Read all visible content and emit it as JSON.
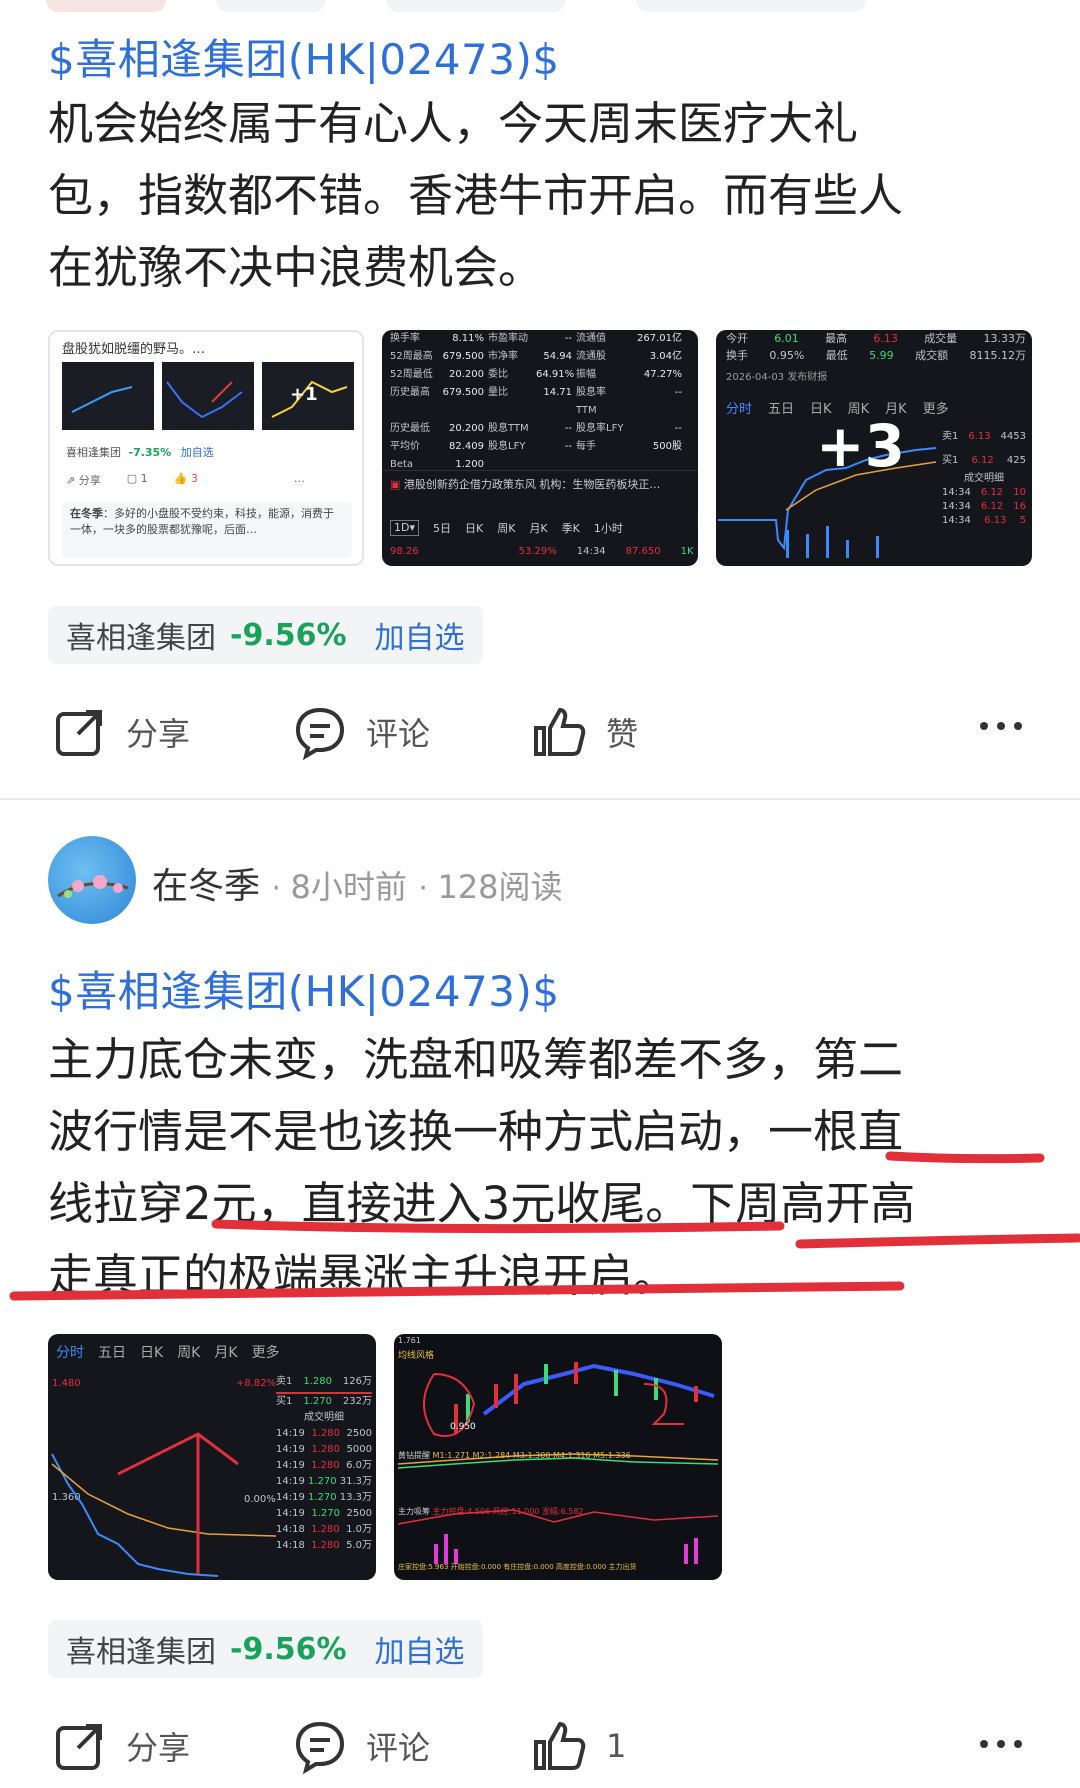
{
  "post1": {
    "stock_link": "$喜相逢集团(HK|02473)$",
    "text_lines": [
      "机会始终属于有心人，今天周末医疗大礼",
      "包，指数都不错。香港牛市开启。而有些人",
      "在犹豫不决中浪费机会。"
    ],
    "thumb1": {
      "title": "盘股犹如脱缰的野马。…",
      "more_badge": "+1",
      "stock_name": "喜相逢集团",
      "stock_pct": "-7.35%",
      "stock_add": "加自选",
      "share": "分享",
      "comment_count": "1",
      "like_count": "3",
      "comment_user": "在冬季",
      "comment_text": "多好的小盘股不受约束，科技，能源，消费于一体，一块多的股票都犹豫呢，后面…"
    },
    "thumb2": {
      "rows": [
        [
          "换手率",
          "8.11%",
          "市盈率动",
          "--",
          "流通值",
          "267.01亿"
        ],
        [
          "52周最高",
          "679.500",
          "市净率",
          "54.94",
          "流通股",
          "3.04亿"
        ],
        [
          "52周最低",
          "20.200",
          "委比",
          "64.91%",
          "振幅",
          "47.27%"
        ],
        [
          "历史最高",
          "679.500",
          "量比",
          "14.71",
          "股息率TTM",
          "--"
        ],
        [
          "历史最低",
          "20.200",
          "股息TTM",
          "--",
          "股息率LFY",
          "--"
        ],
        [
          "平均价",
          "82.409",
          "股息LFY",
          "--",
          "每手",
          "500股"
        ],
        [
          "Beta",
          "1.200",
          "",
          "",
          "",
          ""
        ]
      ],
      "news": "港股创新药企借力政策东风 机构：生物医药板块正…",
      "tabs": [
        "5日",
        "日K",
        "周K",
        "月K",
        "季K",
        "1小时"
      ],
      "bottom": [
        "98.26",
        "53.29%",
        "14:34",
        "87.650",
        "1K"
      ]
    },
    "thumb3": {
      "top_rows": [
        [
          "今开",
          "6.01",
          "最高",
          "6.13",
          "成交量",
          "13.33万"
        ],
        [
          "换手",
          "0.95%",
          "最低",
          "5.99",
          "成交额",
          "8115.12万"
        ]
      ],
      "date_note": "2026-04-03 发布财报",
      "tabs": [
        "分时",
        "五日",
        "日K",
        "周K",
        "月K",
        "更多"
      ],
      "more_badge": "+3",
      "levels": [
        [
          "卖1",
          "6.13",
          "4453"
        ],
        [
          "买1",
          "6.12",
          "425"
        ]
      ],
      "ticks": [
        [
          "14:34",
          "6.12",
          "10"
        ],
        [
          "14:34",
          "6.12",
          "16"
        ],
        [
          "14:34",
          "6.13",
          "5"
        ]
      ],
      "detail": "成交明细"
    },
    "stock_chip": {
      "name": "喜相逢集团",
      "pct": "-9.56%",
      "add": "加自选"
    },
    "actions": {
      "share": "分享",
      "comment": "评论",
      "like": "赞"
    }
  },
  "post2": {
    "author": "在冬季",
    "time": "8小时前",
    "reads": "128阅读",
    "stock_link": "$喜相逢集团(HK|02473)$",
    "text_lines": [
      "主力底仓未变，洗盘和吸筹都差不多，第二",
      "波行情是不是也该换一种方式启动，一根直",
      "线拉穿2元，直接进入3元收尾。下周高开高",
      "走真正的极端暴涨主升浪开启。"
    ],
    "thumb1": {
      "tabs": [
        "分时",
        "五日",
        "日K",
        "周K",
        "月K",
        "更多"
      ],
      "price_hi": "1.480",
      "price_lo": "1.360",
      "pct": "+8.82%",
      "pct0": "0.00%",
      "levels": [
        [
          "卖1",
          "1.280",
          "126万"
        ],
        [
          "买1",
          "1.270",
          "232万"
        ]
      ],
      "detail": "成交明细",
      "ticks": [
        [
          "14:19",
          "1.280",
          "2500"
        ],
        [
          "14:19",
          "1.280",
          "5000"
        ],
        [
          "14:19",
          "1.280",
          "6.0万"
        ],
        [
          "14:19",
          "1.270",
          "31.3万"
        ],
        [
          "14:19",
          "1.270",
          "13.3万"
        ],
        [
          "14:19",
          "1.270",
          "2500"
        ],
        [
          "14:18",
          "1.280",
          "1.0万"
        ],
        [
          "14:18",
          "1.280",
          "5.0万"
        ]
      ]
    },
    "thumb2": {
      "label_top": "1.761",
      "label_style": "均线风格",
      "price_lo": "0.950",
      "ma_line": "M1:1.271 M2:1.284 M3:1.300 M4:1.316 M5:1.336",
      "ind1": "黄钻提醒",
      "ind2": "主力吸筹",
      "ind2_vals": "主力控盘:4.506 风控:11.000 涨幅:6.582",
      "ind3": "庄家控盘:5.963 开始控盘:0.000 有庄控盘:0.000 高度控盘:0.000 主力出货"
    },
    "stock_chip": {
      "name": "喜相逢集团",
      "pct": "-9.56%",
      "add": "加自选"
    },
    "actions": {
      "share": "分享",
      "comment": "评论",
      "like": "1"
    }
  }
}
